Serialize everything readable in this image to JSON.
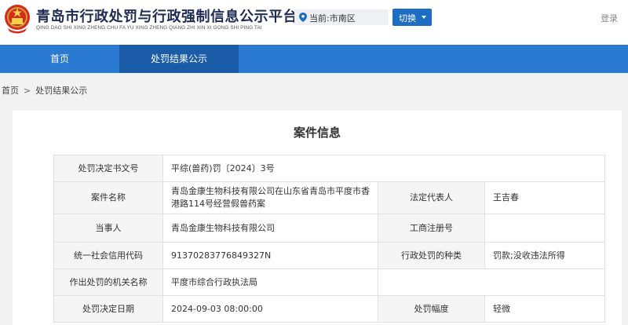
{
  "header": {
    "title": "青岛市行政处罚与行政强制信息公示平台",
    "pinyin": "QING DAO SHI XING ZHENG CHU FA YU XING ZHENG QIANG ZHI XIN XI GONG SHI PING TAI",
    "location_label": "当前:市南区",
    "switch_label": "切换",
    "login_label": "登录"
  },
  "nav": {
    "home": "首页",
    "penalty": "处罚结果公示"
  },
  "breadcrumb": {
    "home": "首页",
    "separator": ">",
    "current": "处罚结果公示"
  },
  "card": {
    "title": "案件信息"
  },
  "case": {
    "decision_no_label": "处罚决定书文号",
    "decision_no": "平综(兽药)罚〔2024〕3号",
    "case_name_label": "案件名称",
    "case_name": "青岛金康生物科技有限公司在山东省青岛市平度市香港路114号经营假兽药案",
    "legal_rep_label": "法定代表人",
    "legal_rep": "王吉春",
    "party_label": "当事人",
    "party": "青岛金康生物科技有限公司",
    "reg_no_label": "工商注册号",
    "reg_no": "",
    "credit_code_label": "统一社会信用代码",
    "credit_code": "91370283776849327N",
    "penalty_type_label": "行政处罚的种类",
    "penalty_type": "罚款;没收违法所得",
    "authority_label": "作出处罚的机关名称",
    "authority": "平度市综合行政执法局",
    "decision_date_label": "处罚决定日期",
    "decision_date": "2024-09-03 08:00:00",
    "penalty_degree_label": "处罚幅度",
    "penalty_degree": "轻微"
  },
  "colors": {
    "nav_bg": "#2a7ad1",
    "nav_active": "#1a5ca8",
    "button": "#1d6ec2",
    "title": "#1f2b54"
  },
  "icons": {
    "emblem": "national-emblem-icon",
    "location": "location-pin-icon",
    "caret": "caret-down-icon"
  }
}
